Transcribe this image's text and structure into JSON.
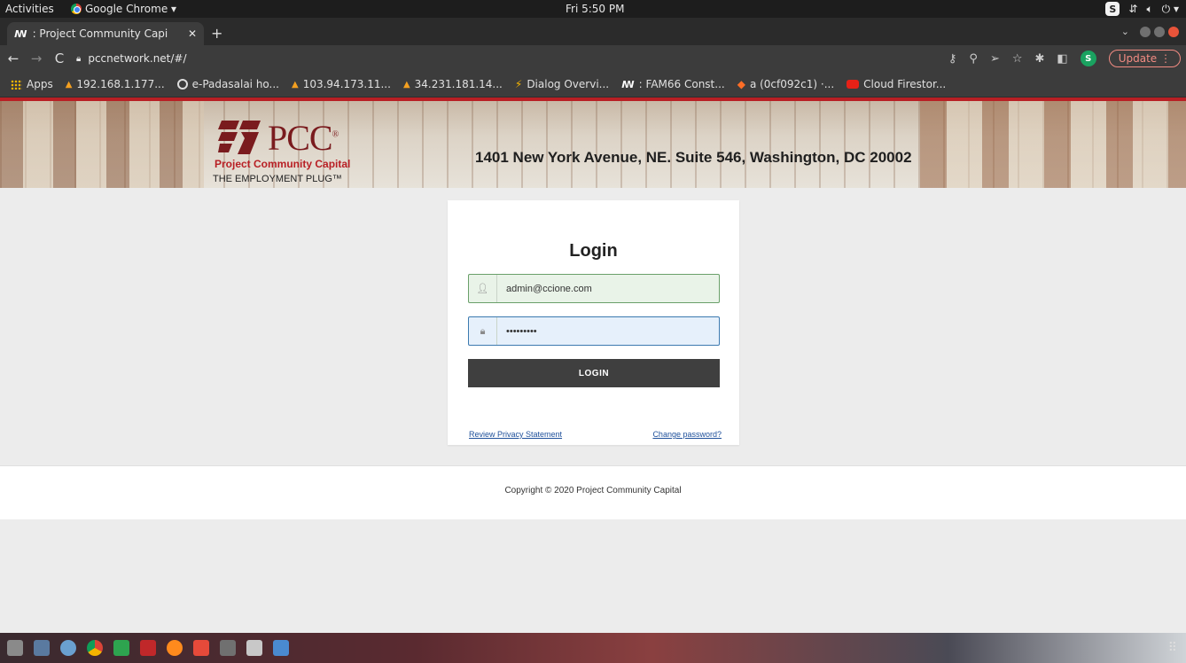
{
  "system": {
    "activities": "Activities",
    "app_name": "Google Chrome ▾",
    "clock": "Fri  5:50 PM",
    "user_badge": "S"
  },
  "tabs": [
    {
      "favicon": "ꟿ",
      "title": ": Project Community Capi"
    }
  ],
  "address_bar": {
    "url": "pccnetwork.net/#/",
    "update_label": "Update",
    "profile_initial": "S"
  },
  "bookmarks": [
    {
      "label": "Apps",
      "icon": "apps-grid-icon"
    },
    {
      "label": "192.168.1.177...",
      "icon": "pma-icon"
    },
    {
      "label": "e-Padasalai ho...",
      "icon": "globe-icon"
    },
    {
      "label": "103.94.173.11...",
      "icon": "pma-icon"
    },
    {
      "label": "34.231.181.14...",
      "icon": "pma-icon"
    },
    {
      "label": "Dialog Overvi...",
      "icon": "bolt-icon"
    },
    {
      "label": ": FAM66 Const...",
      "icon": "w-icon"
    },
    {
      "label": "a (0cf092c1) ·...",
      "icon": "gitlab-fox-icon"
    },
    {
      "label": "Cloud Firestor...",
      "icon": "youtube-icon"
    }
  ],
  "banner": {
    "logo_text": "PCC",
    "logo_registered": "®",
    "logo_org": "Project Community Capital",
    "logo_tagline": "THE EMPLOYMENT PLUG™",
    "address": "1401 New York Avenue, NE. Suite 546, Washington, DC 20002"
  },
  "login": {
    "title": "Login",
    "username_value": "admin@ccione.com",
    "password_value": "•••••••••",
    "button_label": "LOGIN",
    "privacy_link": "Review Privacy Statement",
    "change_password_link": "Change password?"
  },
  "footer": {
    "copyright": "Copyright © 2020 Project Community Capital"
  },
  "colors": {
    "brand_red": "#b81f24",
    "button_dark": "#3f3f3f",
    "link_blue": "#1d4f9a"
  }
}
